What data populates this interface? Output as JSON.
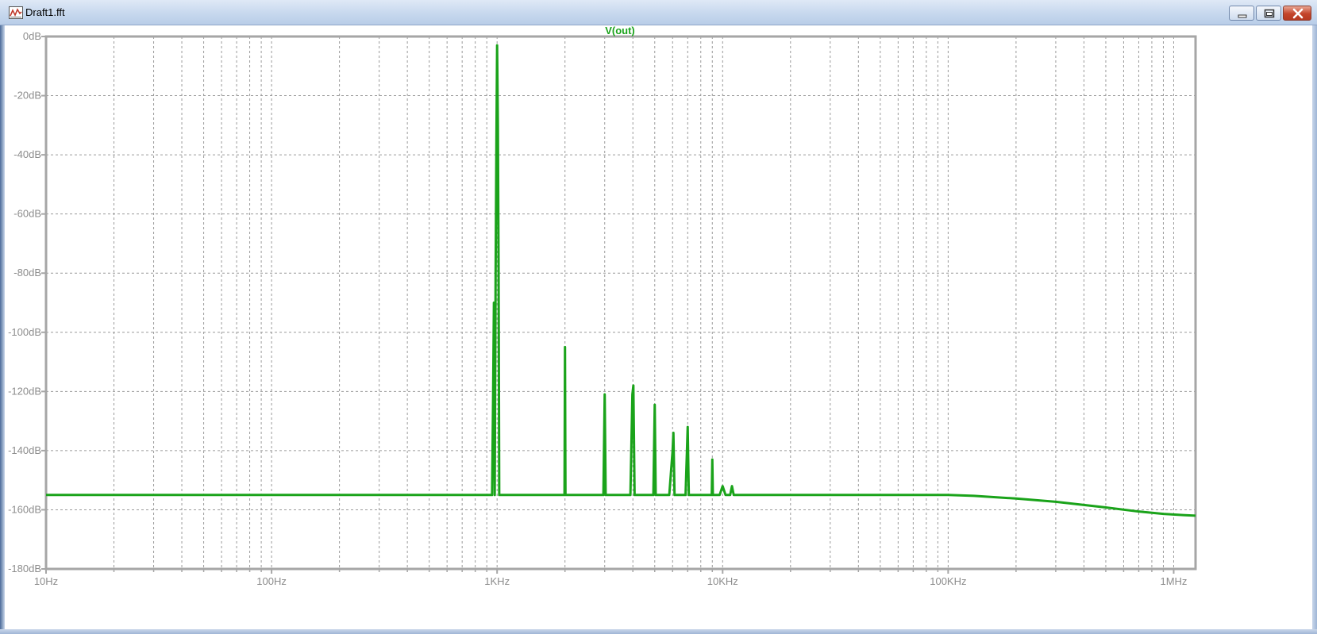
{
  "window": {
    "title": "Draft1.fft",
    "buttons": {
      "minimize": "minimize-icon",
      "maximize": "maximize-icon",
      "close": "close-icon"
    }
  },
  "colors": {
    "trace": "#1aa31a",
    "grid": "#9a9a9a",
    "frame": "#a6a6a6",
    "tick_text": "#8c8c8c",
    "titlebar": "#c7d8ee",
    "close_button": "#c4452b"
  },
  "chart_data": {
    "type": "line",
    "title": "V(out)",
    "xlabel": "",
    "ylabel": "",
    "x_scale": "log",
    "xlim": [
      10,
      1250000
    ],
    "ylim": [
      -180,
      0
    ],
    "grid": true,
    "x_ticks": [
      {
        "value": 10,
        "label": "10Hz"
      },
      {
        "value": 100,
        "label": "100Hz"
      },
      {
        "value": 1000,
        "label": "1KHz"
      },
      {
        "value": 10000,
        "label": "10KHz"
      },
      {
        "value": 100000,
        "label": "100KHz"
      },
      {
        "value": 1000000,
        "label": "1MHz"
      }
    ],
    "y_ticks": [
      {
        "value": 0,
        "label": "0dB"
      },
      {
        "value": -20,
        "label": "-20dB"
      },
      {
        "value": -40,
        "label": "-40dB"
      },
      {
        "value": -60,
        "label": "-60dB"
      },
      {
        "value": -80,
        "label": "-80dB"
      },
      {
        "value": -100,
        "label": "-100dB"
      },
      {
        "value": -120,
        "label": "-120dB"
      },
      {
        "value": -140,
        "label": "-140dB"
      },
      {
        "value": -160,
        "label": "-160dB"
      },
      {
        "value": -180,
        "label": "-180dB"
      }
    ],
    "series": [
      {
        "name": "V(out)",
        "points": [
          [
            10,
            -155
          ],
          [
            950,
            -155
          ],
          [
            960,
            -122
          ],
          [
            968,
            -90
          ],
          [
            976,
            -155
          ],
          [
            985,
            -80
          ],
          [
            993,
            -35
          ],
          [
            1000,
            -3
          ],
          [
            1008,
            -30
          ],
          [
            1015,
            -75
          ],
          [
            1022,
            -155
          ],
          [
            1990,
            -155
          ],
          [
            2000,
            -105
          ],
          [
            2010,
            -155
          ],
          [
            2960,
            -155
          ],
          [
            3000,
            -121
          ],
          [
            3030,
            -155
          ],
          [
            3900,
            -155
          ],
          [
            3980,
            -121
          ],
          [
            4020,
            -118
          ],
          [
            4070,
            -155
          ],
          [
            4930,
            -155
          ],
          [
            5000,
            -124.5
          ],
          [
            5050,
            -155
          ],
          [
            5800,
            -155
          ],
          [
            6000,
            -140
          ],
          [
            6050,
            -134
          ],
          [
            6120,
            -155
          ],
          [
            6850,
            -155
          ],
          [
            7000,
            -132
          ],
          [
            7080,
            -155
          ],
          [
            8950,
            -155
          ],
          [
            9000,
            -143
          ],
          [
            9050,
            -155
          ],
          [
            9700,
            -155
          ],
          [
            10000,
            -152
          ],
          [
            10300,
            -155
          ],
          [
            10800,
            -155
          ],
          [
            11000,
            -152
          ],
          [
            11200,
            -155
          ],
          [
            100000,
            -155
          ],
          [
            130000,
            -155.3
          ],
          [
            200000,
            -156.2
          ],
          [
            300000,
            -157.3
          ],
          [
            500000,
            -159.2
          ],
          [
            700000,
            -160.6
          ],
          [
            900000,
            -161.4
          ],
          [
            1100000,
            -161.8
          ],
          [
            1250000,
            -162
          ]
        ]
      }
    ]
  }
}
